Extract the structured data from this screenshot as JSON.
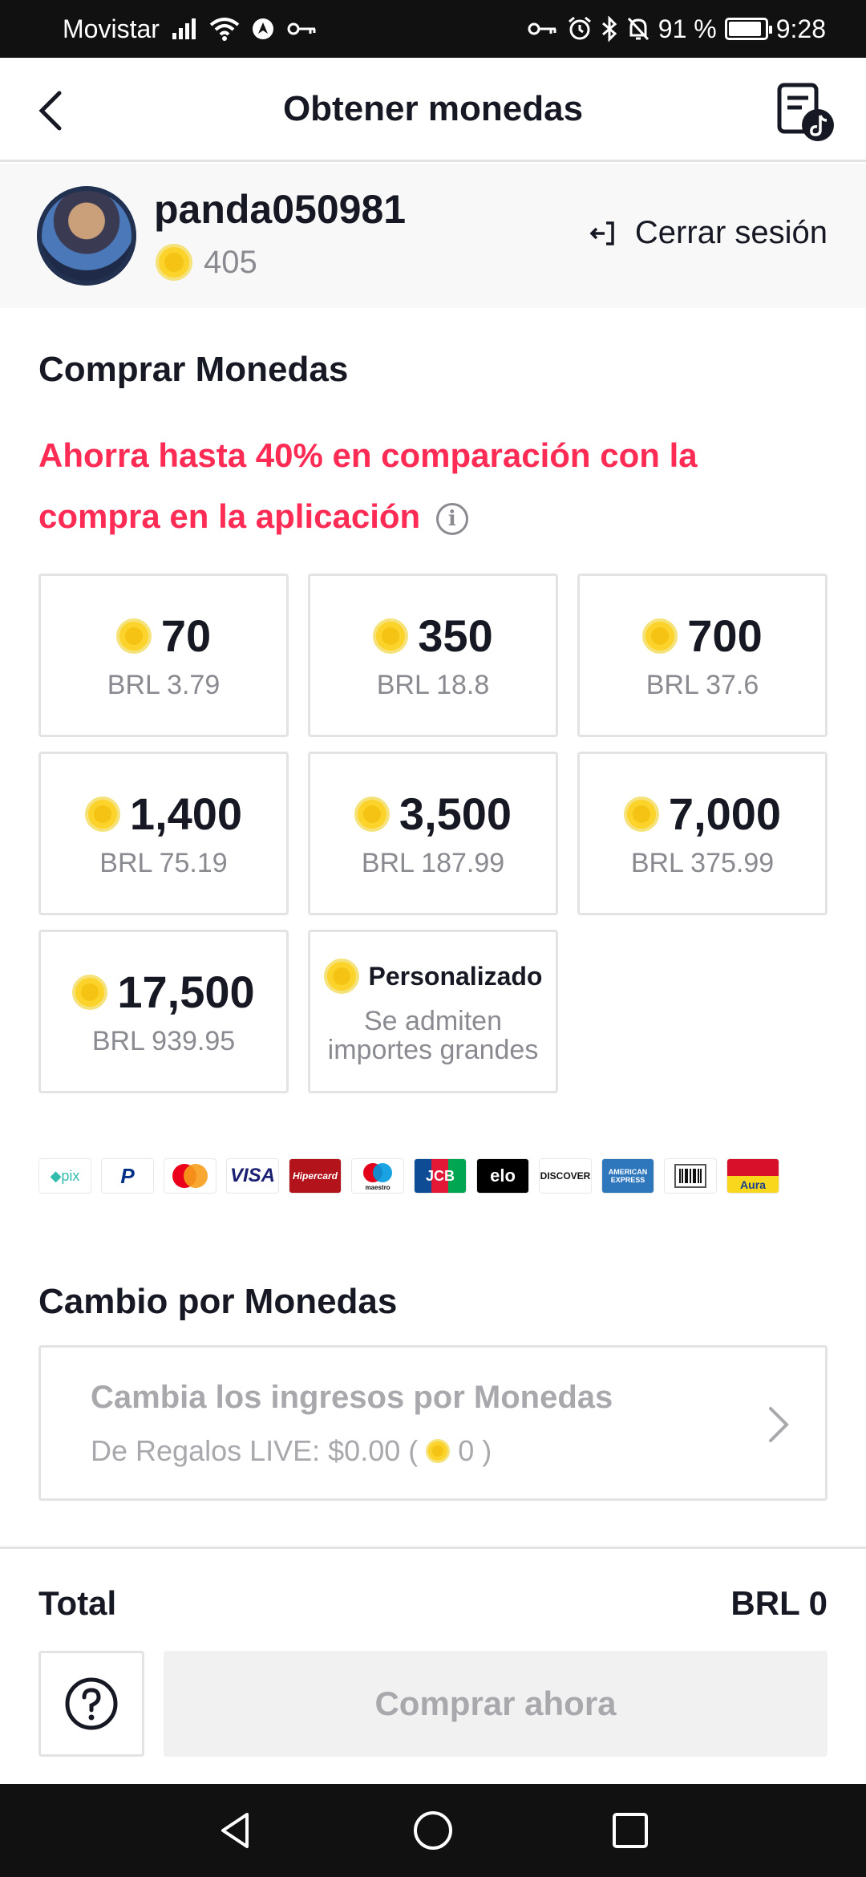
{
  "status_bar": {
    "carrier": "Movistar",
    "battery": "91 %",
    "battery_level": 0.91,
    "time": "9:28"
  },
  "header": {
    "title": "Obtener monedas",
    "back_icon": "chevron-left-icon",
    "history_icon": "transaction-history-icon"
  },
  "profile": {
    "username": "panda050981",
    "coins": "405",
    "logout_label": "Cerrar sesión"
  },
  "buy_section": {
    "title": "Comprar Monedas",
    "promo": "Ahorra hasta 40% en comparación con la compra en la aplicación",
    "packages": [
      {
        "amount": "70",
        "price": "BRL 3.79"
      },
      {
        "amount": "350",
        "price": "BRL 18.8"
      },
      {
        "amount": "700",
        "price": "BRL 37.6"
      },
      {
        "amount": "1,400",
        "price": "BRL 75.19"
      },
      {
        "amount": "3,500",
        "price": "BRL 187.99"
      },
      {
        "amount": "7,000",
        "price": "BRL 375.99"
      },
      {
        "amount": "17,500",
        "price": "BRL 939.95"
      }
    ],
    "custom": {
      "label": "Personalizado",
      "desc": "Se admiten importes grandes"
    }
  },
  "payment_methods": [
    "pix",
    "PayPal",
    "Mastercard",
    "VISA",
    "Hipercard",
    "maestro",
    "JCB",
    "elo",
    "DISCOVER",
    "AMERICAN EXPRESS",
    "Boleto",
    "Aura"
  ],
  "exchange": {
    "title": "Cambio por Monedas",
    "card_title": "Cambia los ingresos por Monedas",
    "card_sub_prefix": "De Regalos LIVE: $0.00 (",
    "card_sub_coins": "0",
    "card_sub_suffix": ")"
  },
  "footer": {
    "total_label": "Total",
    "total_value": "BRL 0",
    "buy_label": "Comprar ahora"
  },
  "colors": {
    "accent": "#fe2c55",
    "coin": "#fcd32a",
    "text": "#161823",
    "muted": "#8a8b91"
  }
}
